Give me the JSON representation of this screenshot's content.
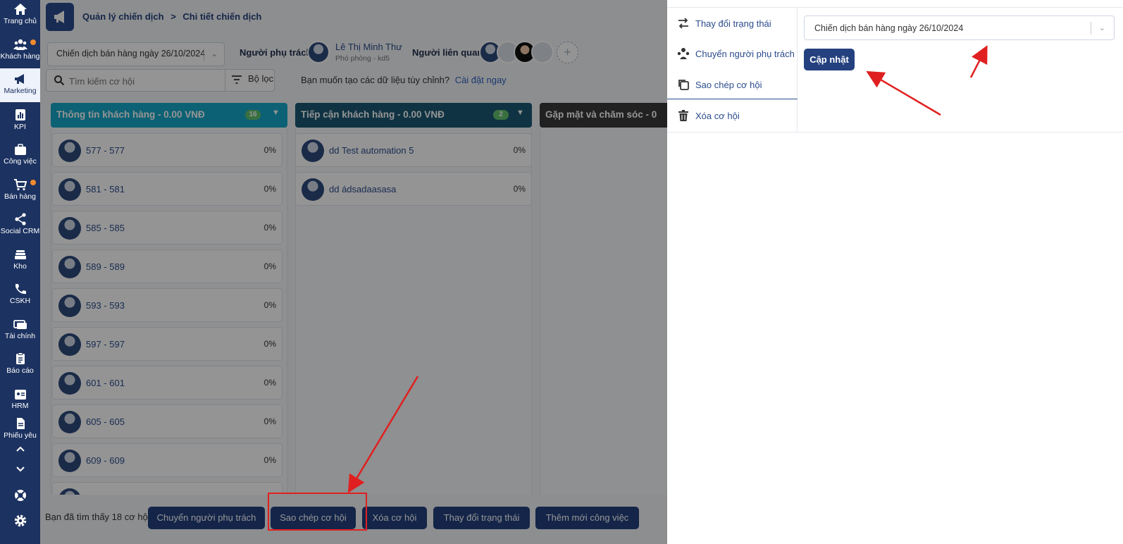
{
  "sidebar": {
    "items": [
      {
        "label": "Trang chủ",
        "icon": "home-icon"
      },
      {
        "label": "Khách hàng",
        "icon": "users-icon",
        "badge": true
      },
      {
        "label": "Marketing",
        "icon": "megaphone-icon",
        "active": true
      },
      {
        "label": "KPI",
        "icon": "chart-icon"
      },
      {
        "label": "Công việc",
        "icon": "briefcase-icon"
      },
      {
        "label": "Bán hàng",
        "icon": "cart-icon",
        "badge": true
      },
      {
        "label": "Social CRM",
        "icon": "share-icon"
      },
      {
        "label": "Kho",
        "icon": "warehouse-icon"
      },
      {
        "label": "CSKH",
        "icon": "phone-icon"
      },
      {
        "label": "Tài chính",
        "icon": "money-icon"
      },
      {
        "label": "Báo cáo",
        "icon": "clipboard-icon"
      },
      {
        "label": "HRM",
        "icon": "id-card-icon"
      },
      {
        "label": "Phiếu yêu",
        "icon": "document-icon"
      }
    ]
  },
  "breadcrumb": {
    "parent": "Quản lý chiến dịch",
    "separator": ">",
    "current": "Chi tiết chiến dịch"
  },
  "campaign": {
    "selected": "Chiến dịch bán hàng ngày 26/10/2024"
  },
  "owner": {
    "label": "Người phụ trách",
    "name": "Lê Thị Minh Thư",
    "role": "Phó phòng - kd5"
  },
  "related": {
    "label": "Người liên quan",
    "add_symbol": "+"
  },
  "search": {
    "placeholder": "Tìm kiếm cơ hội",
    "filter_label": "Bộ lọc"
  },
  "custom_data": {
    "question": "Bạn muốn tạo các dữ liệu tùy chỉnh?",
    "link": "Cài đặt ngay"
  },
  "columns": [
    {
      "title": "Thông tin khách hàng - 0.00 VNĐ",
      "count": "16",
      "color": "#17a8c8",
      "cards": [
        {
          "name": "577 - 577",
          "pct": "0%"
        },
        {
          "name": "581 - 581",
          "pct": "0%"
        },
        {
          "name": "585 - 585",
          "pct": "0%"
        },
        {
          "name": "589 - 589",
          "pct": "0%"
        },
        {
          "name": "593 - 593",
          "pct": "0%"
        },
        {
          "name": "597 - 597",
          "pct": "0%"
        },
        {
          "name": "601 - 601",
          "pct": "0%"
        },
        {
          "name": "605 - 605",
          "pct": "0%"
        },
        {
          "name": "609 - 609",
          "pct": "0%"
        }
      ]
    },
    {
      "title": "Tiếp cận khách hàng - 0.00 VNĐ",
      "count": "2",
      "color": "#1a5874",
      "cards": [
        {
          "name": "dd Test automation 5",
          "pct": "0%"
        },
        {
          "name": "dd ádsadaasasa",
          "pct": "0%"
        }
      ]
    },
    {
      "title": "Gặp mặt và chăm sóc - 0",
      "color": "#3a3a3a",
      "cards": []
    }
  ],
  "footer": {
    "found_text": "Bạn đã tìm thấy 18 cơ hội",
    "buttons": [
      {
        "label": "Chuyển người phụ trách"
      },
      {
        "label": "Sao chép cơ hội"
      },
      {
        "label": "Xóa cơ hội"
      },
      {
        "label": "Thay đổi trạng thái"
      },
      {
        "label": "Thêm mới công việc"
      }
    ]
  },
  "panel": {
    "menu": [
      {
        "label": "Thay đổi trạng thái",
        "icon": "swap-icon"
      },
      {
        "label": "Chuyển người phụ trách",
        "icon": "transfer-user-icon"
      },
      {
        "label": "Sao chép cơ hội",
        "icon": "copy-icon",
        "active": true
      },
      {
        "label": "Xóa cơ hội",
        "icon": "trash-icon"
      }
    ],
    "target_campaign": "Chiến dịch bán hàng ngày 26/10/2024",
    "update_label": "Cập nhật"
  },
  "colors": {
    "nav_bg": "#1c3260",
    "primary": "#24407f",
    "annotation": "#e02020"
  }
}
